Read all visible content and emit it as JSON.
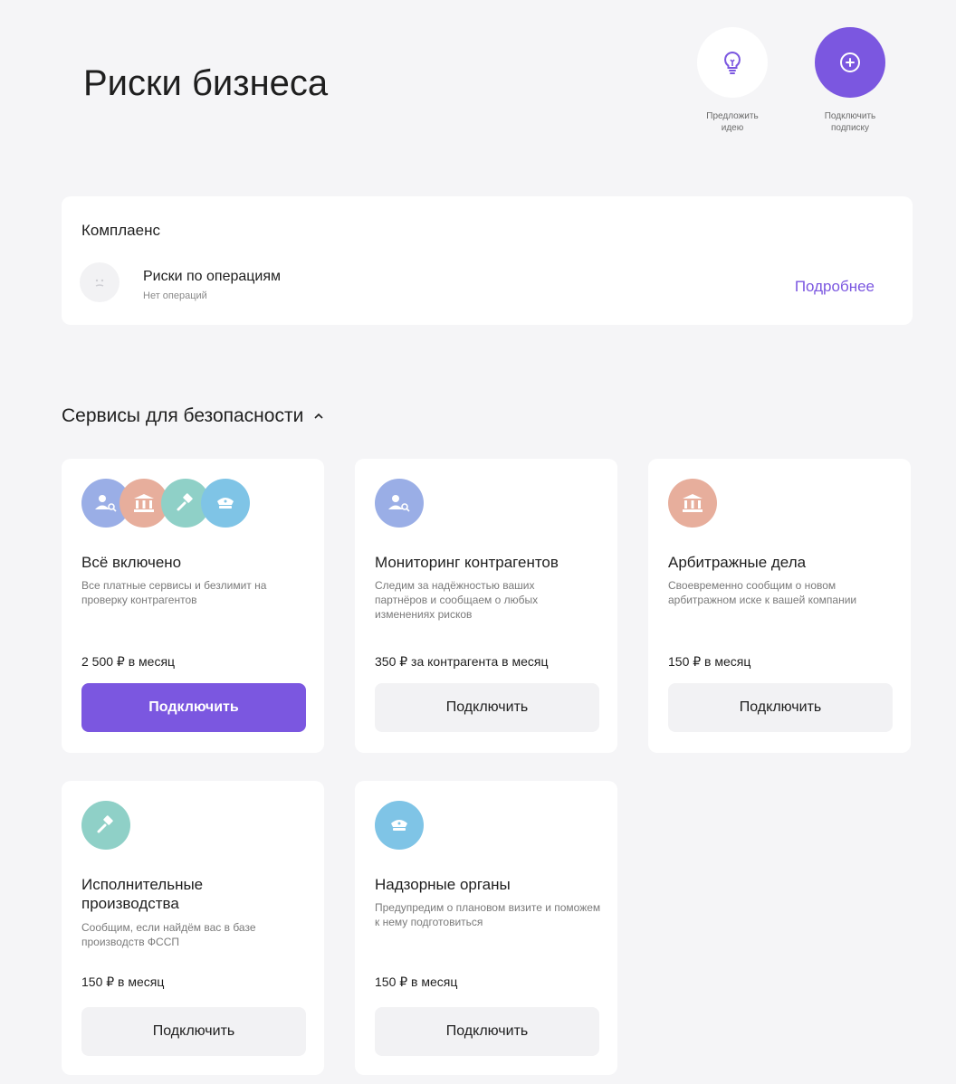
{
  "page": {
    "title": "Риски бизнеса"
  },
  "actions": {
    "suggest_idea": "Предложить\nидею",
    "subscribe": "Подключить\nподписку"
  },
  "compliance": {
    "heading": "Комплаенс",
    "item_title": "Риски по операциям",
    "item_subtitle": "Нет операций",
    "more_link": "Подробнее"
  },
  "services": {
    "title": "Сервисы для безопасности",
    "cards": [
      {
        "title": "Всё включено",
        "description": "Все платные сервисы и безлимит на проверку контрагентов",
        "price": "2 500 ₽ в месяц",
        "button": "Подключить"
      },
      {
        "title": "Мониторинг контрагентов",
        "description": "Следим за надёжностью ваших партнёров и сообщаем о любых изменениях рисков",
        "price": "350 ₽ за контрагента в месяц",
        "button": "Подключить"
      },
      {
        "title": "Арбитражные дела",
        "description": "Своевременно сообщим о новом арбитражном иске к вашей компании",
        "price": "150 ₽ в месяц",
        "button": "Подключить"
      },
      {
        "title": "Исполнительные производства",
        "description": "Сообщим, если найдём вас в базе производств ФССП",
        "price": "150 ₽ в месяц",
        "button": "Подключить"
      },
      {
        "title": "Надзорные органы",
        "description": "Предупредим о плановом визите и поможем к нему подготовиться",
        "price": "150 ₽ в месяц",
        "button": "Подключить"
      }
    ]
  },
  "colors": {
    "accent": "#7b57e0",
    "users_icon": "#9aaee6",
    "court_icon": "#e7ae9c",
    "hammer_icon": "#8fd0c7",
    "cap_icon": "#7fc4e6"
  }
}
